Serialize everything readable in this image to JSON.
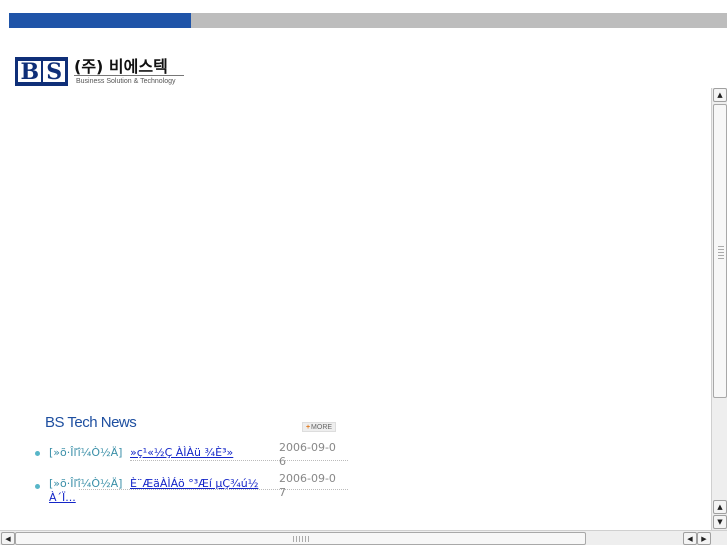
{
  "logo": {
    "mark_letters": [
      "B",
      "S"
    ],
    "korean_name": "(주) 비에스텍",
    "tagline": "Business Solution & Technology"
  },
  "news": {
    "title": "BS Tech News",
    "more_plus": "+",
    "more_label": "MORE",
    "items": [
      {
        "category": "[»õ·Îľî¼Ò½Ä]",
        "title": "»ç¹«½Ç ÀÌÀü ¾È³»",
        "title_cont": "",
        "date": "2006-09-06"
      },
      {
        "category": "[»õ·Îľî¼Ò½Ä]",
        "title": "È¨ÆäÀÌÁö °³Æí µÇ¾ú½",
        "title_cont": "À´Ï...",
        "date": "2006-09-07"
      }
    ]
  },
  "scrollbars": {
    "up_glyph": "▲",
    "down_glyph": "▼",
    "left_glyph": "◀",
    "right_glyph": "▶"
  },
  "colors": {
    "topbar_blue": "#1f54a8",
    "topbar_gray": "#bdbdbd",
    "news_title": "#1e4fa0",
    "link": "#1426c8",
    "category": "#3a8fa8"
  }
}
